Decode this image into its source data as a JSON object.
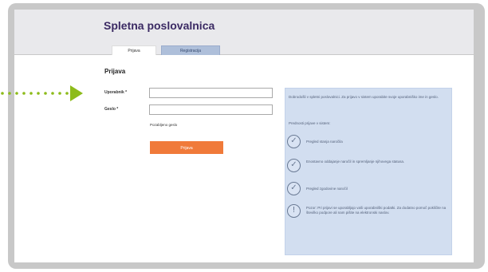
{
  "app": {
    "title": "Spletna poslovalnica"
  },
  "tabs": [
    {
      "label": "Prijava"
    },
    {
      "label": "Registracija"
    }
  ],
  "login": {
    "title": "Prijava",
    "username_label": "Uporabnik *",
    "password_label": "Geslo *",
    "forgot_link": "Pozabljeno geslo",
    "submit_label": "Prijava"
  },
  "info": {
    "intro": "Dobrodošli v spletni poslovalnici. Za prijavo v sistem uporabite svoje uporabniško ime in geslo.",
    "subtitle": "Prednosti prijave v sistem:",
    "items": [
      {
        "icon": "check-icon",
        "text": "Pregled stanja naročila"
      },
      {
        "icon": "check-icon",
        "text": "Enostavno oddajanje naročil in spremljanje njihovega statusa."
      },
      {
        "icon": "check-icon",
        "text": "Pregled zgodovine naročil"
      },
      {
        "icon": "info-icon",
        "text": "Pozor: Pri prijavi se uporabljajo vaši uporabniški podatki. Za dodatno pomoč pokličite na številko podpore ali nam pišite na elektronski naslov."
      }
    ]
  },
  "colors": {
    "accent": "#f07a3a",
    "header_title": "#3b2a63",
    "panel_bg": "#d2def0",
    "arrow": "#8dbb1a"
  }
}
